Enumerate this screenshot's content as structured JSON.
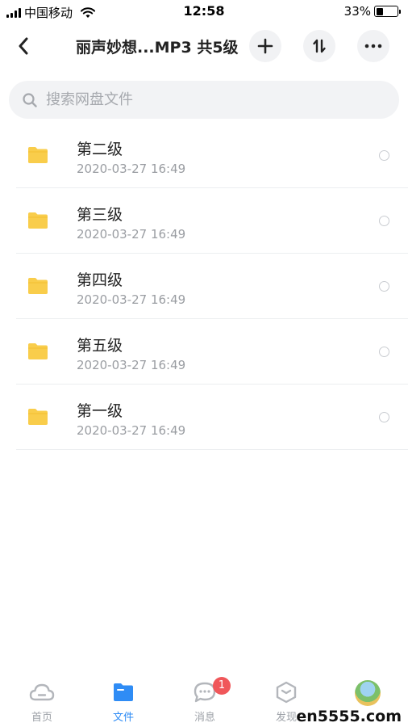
{
  "status_bar": {
    "carrier": "中国移动",
    "time": "12:58",
    "battery": "33%"
  },
  "nav": {
    "title": "丽声妙想...MP3 共5级"
  },
  "search": {
    "placeholder": "搜索网盘文件"
  },
  "files": [
    {
      "name": "第二级",
      "date": "2020-03-27 16:49"
    },
    {
      "name": "第三级",
      "date": "2020-03-27 16:49"
    },
    {
      "name": "第四级",
      "date": "2020-03-27 16:49"
    },
    {
      "name": "第五级",
      "date": "2020-03-27 16:49"
    },
    {
      "name": "第一级",
      "date": "2020-03-27 16:49"
    }
  ],
  "tabbar": {
    "tabs": [
      {
        "label": "首页",
        "icon": "cloud-icon"
      },
      {
        "label": "文件",
        "icon": "folder-icon",
        "active": true
      },
      {
        "label": "消息",
        "icon": "chat-icon",
        "badge": "1"
      },
      {
        "label": "发现",
        "icon": "cube-icon"
      },
      {
        "label": "",
        "icon": "avatar"
      }
    ]
  },
  "watermark": "en5555.com",
  "colors": {
    "accent": "#2f8cf5",
    "folder": "#f9cd4b",
    "badge": "#f0575a"
  }
}
